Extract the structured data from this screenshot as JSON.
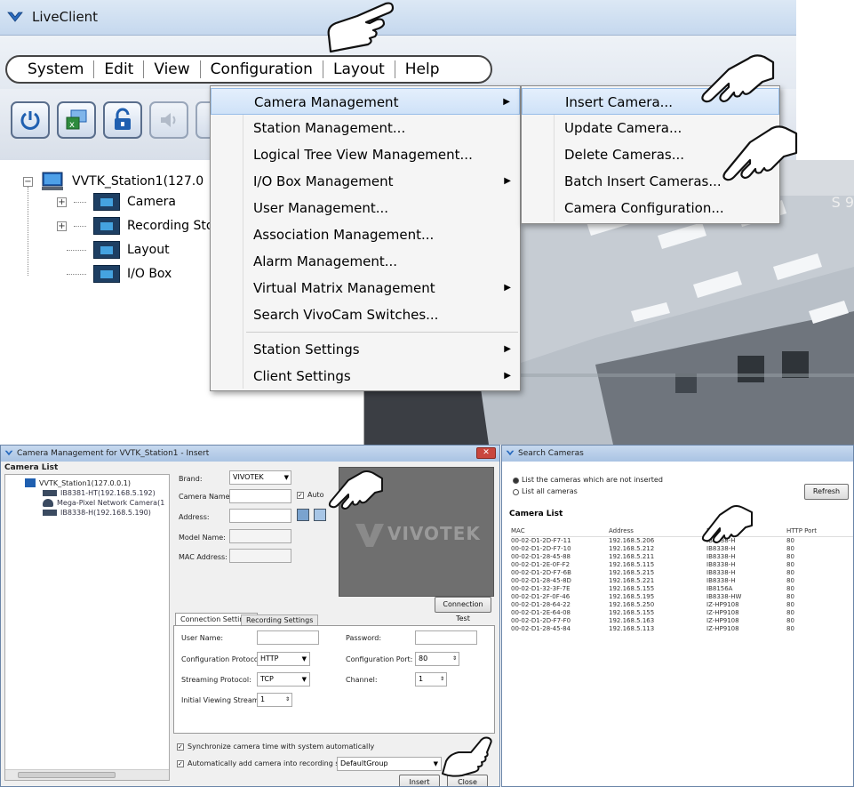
{
  "live": {
    "title": "LiveClient",
    "menus": [
      "System",
      "Edit",
      "View",
      "Configuration",
      "Layout",
      "Help"
    ],
    "tree": {
      "station": "VVTK_Station1(127.0",
      "items": [
        "Camera",
        "Recording Stor…",
        "Layout",
        "I/O Box"
      ]
    },
    "cam_label_partial": "S 9"
  },
  "config_menu": {
    "items": [
      {
        "label": "Camera Management",
        "submenu": true
      },
      {
        "label": "Station Management...",
        "submenu": false
      },
      {
        "label": "Logical Tree View Management...",
        "submenu": false
      },
      {
        "label": "I/O Box Management",
        "submenu": true
      },
      {
        "label": "User Management...",
        "submenu": false
      },
      {
        "label": "Association Management...",
        "submenu": false
      },
      {
        "label": "Alarm Management...",
        "submenu": false
      },
      {
        "label": "Virtual Matrix Management",
        "submenu": true
      },
      {
        "label": "Search VivoCam Switches...",
        "submenu": false
      },
      {
        "label": "Station Settings",
        "submenu": true
      },
      {
        "label": "Client Settings",
        "submenu": true
      }
    ]
  },
  "camera_submenu": {
    "items": [
      "Insert Camera...",
      "Update Camera...",
      "Delete Cameras...",
      "Batch Insert Cameras...",
      "Camera Configuration..."
    ]
  },
  "cm_dialog": {
    "title": "Camera Management for VVTK_Station1 - Insert",
    "list_header": "Camera List",
    "tree": [
      "VVTK_Station1(127.0.0.1)",
      "IB8381-HT(192.168.5.192)",
      "Mega-Pixel Network Camera(1",
      "IB8338-H(192.168.5.190)"
    ],
    "labels": {
      "brand": "Brand:",
      "camera_name": "Camera Name:",
      "address": "Address:",
      "model_name": "Model Name:",
      "mac": "MAC Address:",
      "auto": "Auto",
      "user_name": "User Name:",
      "password": "Password:",
      "config_protocol": "Configuration Protocol:",
      "config_port": "Configuration Port:",
      "stream_protocol": "Streaming Protocol:",
      "channel": "Channel:",
      "initial_stream": "Initial Viewing Stream:",
      "sync_time": "Synchronize camera time with system automatically",
      "auto_add": "Automatically add camera into recording storage"
    },
    "values": {
      "brand": "VIVOTEK",
      "config_protocol": "HTTP",
      "config_port": "80",
      "stream_protocol": "TCP",
      "channel": "1",
      "initial_stream": "1",
      "storage": "DefaultGroup"
    },
    "tabs": [
      "Connection Settings",
      "Recording Settings"
    ],
    "buttons": {
      "connection_test": "Connection Test",
      "insert": "Insert",
      "close": "Close"
    },
    "logo": "VIVOTEK"
  },
  "search_dialog": {
    "title": "Search Cameras",
    "option1": "List the cameras which are not inserted",
    "option2": "List all cameras",
    "refresh": "Refresh",
    "list_header": "Camera List",
    "columns": [
      "MAC",
      "Address",
      "Model",
      "HTTP Port"
    ],
    "rows": [
      [
        "00-02-D1-2D-F7-11",
        "192.168.5.206",
        "IB8338-H",
        "80"
      ],
      [
        "00-02-D1-2D-F7-10",
        "192.168.5.212",
        "IB8338-H",
        "80"
      ],
      [
        "00-02-D1-28-45-88",
        "192.168.5.211",
        "IB8338-H",
        "80"
      ],
      [
        "00-02-D1-2E-0F-F2",
        "192.168.5.115",
        "IB8338-H",
        "80"
      ],
      [
        "00-02-D1-2D-F7-6B",
        "192.168.5.215",
        "IB8338-H",
        "80"
      ],
      [
        "00-02-D1-28-45-8D",
        "192.168.5.221",
        "IB8338-H",
        "80"
      ],
      [
        "00-02-D1-32-3F-7E",
        "192.168.5.155",
        "IB8156A",
        "80"
      ],
      [
        "00-02-D1-2F-0F-46",
        "192.168.5.195",
        "IB8338-HW",
        "80"
      ],
      [
        "00-02-D1-28-64-22",
        "192.168.5.250",
        "IZ-HP9108",
        "80"
      ],
      [
        "00-02-D1-2E-64-08",
        "192.168.5.155",
        "IZ-HP9108",
        "80"
      ],
      [
        "00-02-D1-2D-F7-F0",
        "192.168.5.163",
        "IZ-HP9108",
        "80"
      ],
      [
        "00-02-D1-28-45-84",
        "192.168.5.113",
        "IZ-HP9108",
        "80"
      ]
    ]
  },
  "colors": {
    "menu_highlight": "#cfe2f8",
    "title_bar": "#c5d8ee",
    "folder_dark": "#1e3f63",
    "folder_light": "#45a3e0"
  }
}
